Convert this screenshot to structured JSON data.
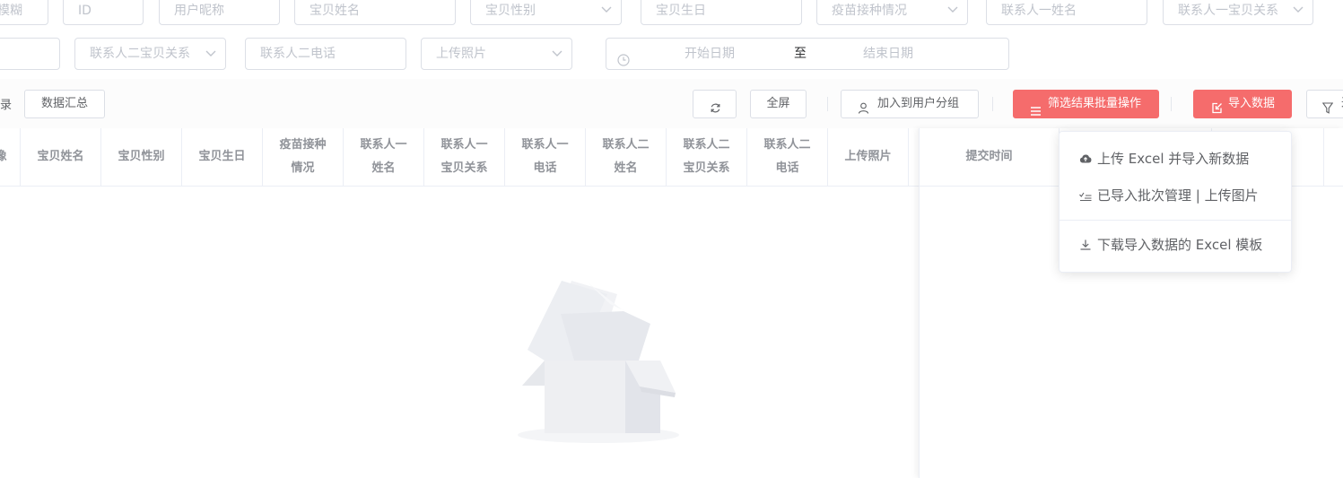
{
  "filters": {
    "row1": [
      {
        "placeholder": "模糊"
      },
      {
        "placeholder": "ID"
      },
      {
        "placeholder": "用户昵称"
      },
      {
        "placeholder": "宝贝姓名"
      },
      {
        "placeholder": "宝贝性别"
      },
      {
        "placeholder": "宝贝生日"
      },
      {
        "placeholder": "疫苗接种情况"
      },
      {
        "placeholder": "联系人一姓名"
      },
      {
        "placeholder": "联系人一宝贝关系"
      }
    ],
    "row2": [
      {
        "placeholder": ""
      },
      {
        "placeholder": "联系人二宝贝关系"
      },
      {
        "placeholder": "联系人二电话"
      },
      {
        "placeholder": "上传照片"
      }
    ],
    "date_range": {
      "start": "开始日期",
      "sep": "至",
      "end": "结束日期"
    }
  },
  "toolbar": {
    "left_text": "录",
    "summary": "数据汇总",
    "fullscreen": "全屏",
    "add_group": "加入到用户分组",
    "batch": "筛选结果批量操作",
    "import": "导入数据",
    "filter": "过"
  },
  "table": {
    "headers": [
      "像",
      "宝贝姓名",
      "宝贝性别",
      "宝贝生日",
      "疫苗接种\n情况",
      "联系人一\n姓名",
      "联系人一\n宝贝关系",
      "联系人一\n电话",
      "联系人二\n姓名",
      "联系人二\n宝贝关系",
      "联系人二\n电话",
      "上传照片",
      "提交时间"
    ]
  },
  "import_menu": {
    "items": [
      {
        "label": "上传 Excel 并导入新数据",
        "icon": "cloud-upload-icon"
      },
      {
        "label": "已导入批次管理 | 上传图片",
        "icon": "list-check-icon"
      },
      {
        "label": "下载导入数据的 Excel 模板",
        "icon": "download-icon"
      }
    ]
  },
  "colors": {
    "accent": "#f56c6c",
    "border": "#dcdfe6",
    "placeholder": "#c0c4cc"
  }
}
